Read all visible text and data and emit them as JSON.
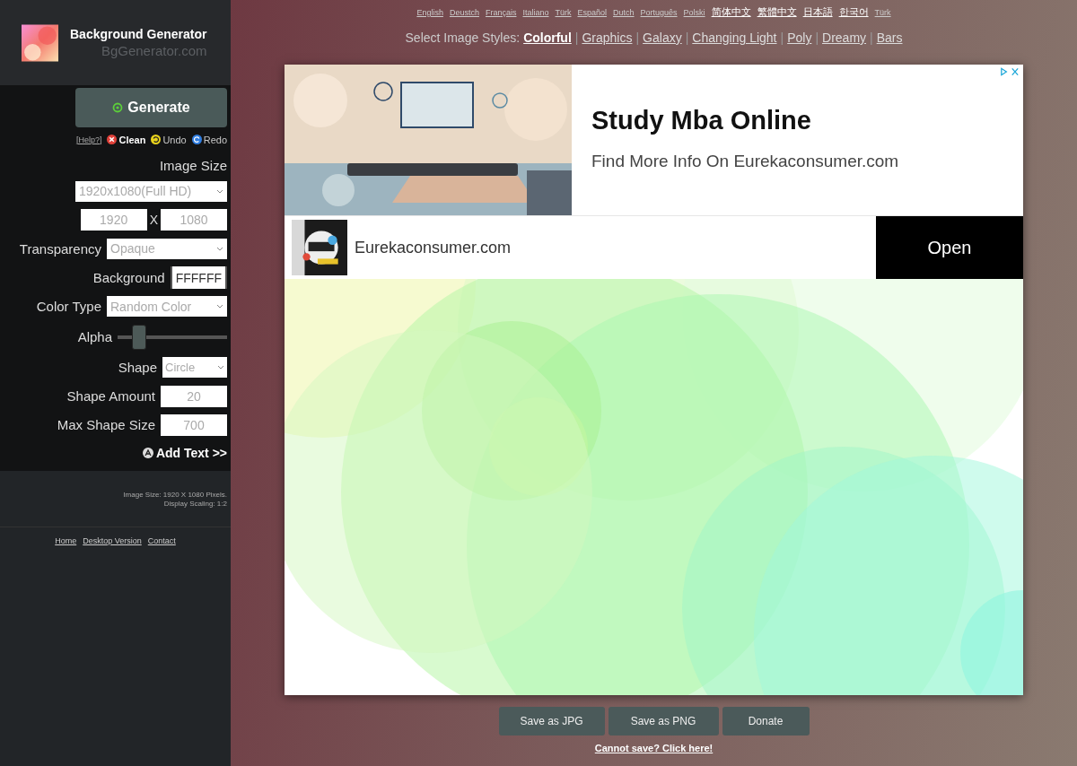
{
  "brand": {
    "title": "Background Generator",
    "domain": "BgGenerator.com"
  },
  "sidebar": {
    "generate": "Generate",
    "actions": [
      {
        "kind": "help",
        "label": "[Help?]"
      },
      {
        "kind": "clean",
        "label": "Clean"
      },
      {
        "kind": "undo",
        "label": "Undo"
      },
      {
        "kind": "redo",
        "label": "Redo"
      }
    ],
    "heading": "Image Size",
    "fields": [
      {
        "kind": "select",
        "value": "1920x1080(Full HD)"
      },
      {
        "kind": "size",
        "width_placeholder": "1920",
        "separator": "X",
        "height_placeholder": "1080"
      },
      {
        "kind": "select",
        "label": "Transparency",
        "value": "Opaque"
      },
      {
        "kind": "color",
        "label": "Background",
        "value": "FFFFFF"
      },
      {
        "kind": "select",
        "label": "Color Type",
        "value": "Random Color"
      },
      {
        "kind": "slider",
        "label": "Alpha",
        "level": 0.2
      },
      {
        "kind": "select",
        "label": "Shape",
        "value": "Circle"
      },
      {
        "kind": "input",
        "label": "Shape Amount",
        "placeholder": "20"
      },
      {
        "kind": "input",
        "label": "Max Shape Size",
        "placeholder": "700"
      }
    ],
    "add_text": "Add Text >>",
    "info": [
      "Image Size: 1920 X 1080 Pixels.",
      "Display Scaling: 1:2"
    ],
    "footer_links": [
      "Home",
      "Desktop Version",
      "Contact"
    ]
  },
  "languages": [
    "English",
    "Deustch",
    "Français",
    "Italiano",
    "Türk",
    "Español",
    "Dutch",
    "Português",
    "Polski",
    "简体中文",
    "繁體中文",
    "日本語",
    "한국어",
    "Türk"
  ],
  "styles": {
    "label": "Select Image Styles:",
    "separator": "|",
    "items": [
      {
        "label": "Colorful",
        "selected": true
      },
      {
        "label": "Graphics",
        "selected": false
      },
      {
        "label": "Galaxy",
        "selected": false
      },
      {
        "label": "Changing Light",
        "selected": false
      },
      {
        "label": "Poly",
        "selected": false
      },
      {
        "label": "Dreamy",
        "selected": false
      },
      {
        "label": "Bars",
        "selected": false
      }
    ]
  },
  "ad": {
    "headline": "Study Mba Online",
    "text": "Find More Info On Eurekaconsumer.com",
    "site": "Eurekaconsumer.com",
    "button": "Open"
  },
  "buttons": [
    "Save as JPG",
    "Save as PNG",
    "Donate"
  ],
  "help_link": "Cannot save? Click here!"
}
